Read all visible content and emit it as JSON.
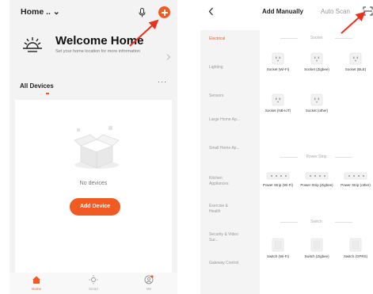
{
  "colors": {
    "accent": "#f05a23",
    "background": "#f3f3f3"
  },
  "home_screen": {
    "home_title": "Home .. ⌄",
    "welcome_title": "Welcome Home",
    "welcome_subtitle": "Set your home location for more information",
    "all_devices_label": "All Devices",
    "more_label": "···",
    "empty_text": "No devices",
    "add_device_label": "Add Device",
    "tabs": [
      {
        "label": "Home",
        "icon": "home-icon"
      },
      {
        "label": "Smart",
        "icon": "smart-sun-icon"
      },
      {
        "label": "Me",
        "icon": "me-icon"
      }
    ]
  },
  "add_screen": {
    "tab_manual": "Add Manually",
    "tab_auto": "Auto Scan",
    "categories": [
      "Electrical",
      "Lighting",
      "Sensors",
      "Large Home Ap...",
      "Small Home Ap...",
      "Kitchen Appliances",
      "Exercise & Health",
      "Security & Video Sur...",
      "Gateway Control"
    ],
    "sections": [
      {
        "title": "Socket",
        "items": [
          "Socket (Wi-Fi)",
          "Socket (Zigbee)",
          "Socket (BLE)",
          "Socket (NB-IoT)",
          "Socket (other)"
        ]
      },
      {
        "title": "Power Strip",
        "items": [
          "Power Strip (Wi-Fi)",
          "Power Strip (Zigbee)",
          "Power Strip (other)"
        ]
      },
      {
        "title": "Switch",
        "items": [
          "Switch (Wi-Fi)",
          "Switch (Zigbee)",
          "Switch (GPRS)"
        ]
      }
    ]
  }
}
